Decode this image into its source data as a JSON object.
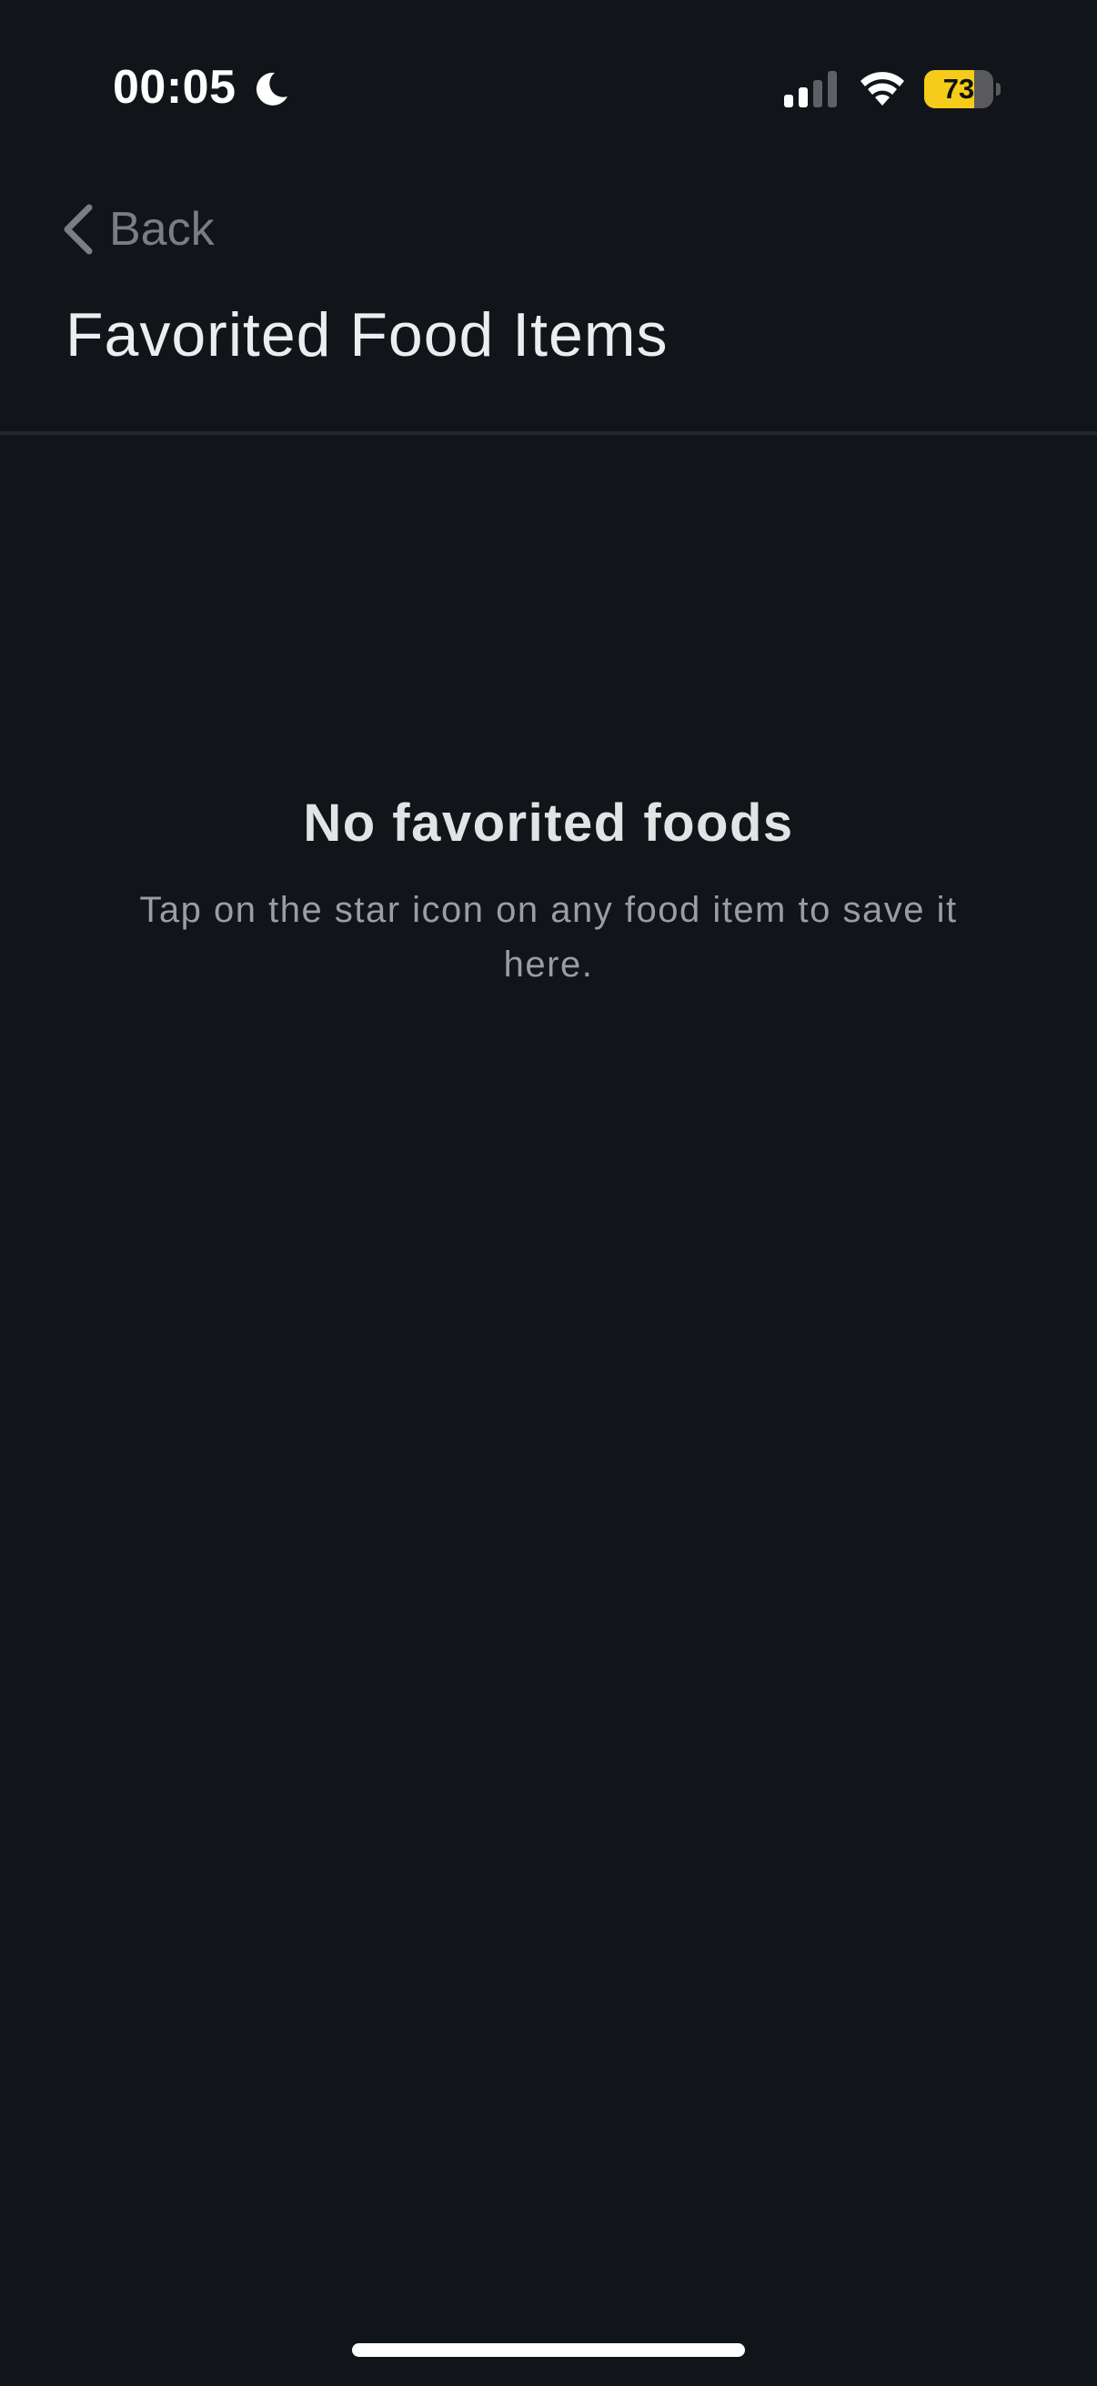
{
  "status_bar": {
    "time": "00:05",
    "focus_icon": "moon-icon",
    "signal_icon": "cellular-signal-icon",
    "wifi_icon": "wifi-icon",
    "battery_level": "73",
    "battery_fraction": 0.73,
    "battery_color": "#f5cc19"
  },
  "nav": {
    "back_label": "Back",
    "back_icon": "chevron-left-icon",
    "title": "Favorited Food Items"
  },
  "empty_state": {
    "title": "No favorited foods",
    "message": "Tap on the star icon on any food item to save it here."
  },
  "colors": {
    "background": "#111418",
    "divider": "#24282d",
    "primary_text": "#ecedef",
    "secondary_text": "#9a9da2",
    "back_text": "#7a7d82"
  }
}
